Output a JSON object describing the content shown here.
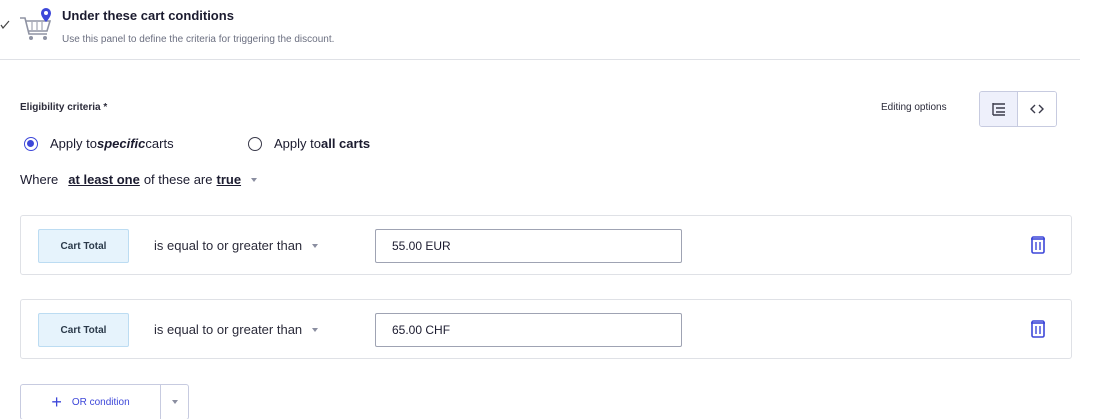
{
  "header": {
    "title": "Under these cart conditions",
    "description": "Use this panel to define the criteria for triggering the discount."
  },
  "eligibility": {
    "label": "Eligibility criteria *",
    "editing_options_label": "Editing options"
  },
  "radios": [
    {
      "prefix": "Apply to ",
      "emphasis": "specific",
      "suffix": " carts",
      "checked": true
    },
    {
      "prefix": "Apply to ",
      "emphasis": "all carts",
      "suffix": "",
      "checked": false
    }
  ],
  "where": {
    "prefix": "Where",
    "quantifier": "at least one",
    "middle": "of these are",
    "value": "true"
  },
  "conditions": [
    {
      "field": "Cart Total",
      "operator": "is equal to or greater than",
      "value": "55.00 EUR"
    },
    {
      "field": "Cart Total",
      "operator": "is equal to or greater than",
      "value": "65.00 CHF"
    }
  ],
  "or_button": {
    "label": "OR condition"
  },
  "colors": {
    "accent": "#3d47d9",
    "tag_bg": "#e6f3fc",
    "border": "#dfe1e6"
  },
  "icons": [
    "collapse-check-icon",
    "cart-icon",
    "tree-view-icon",
    "code-view-icon",
    "trash-icon",
    "plus-icon",
    "chevron-down-icon"
  ]
}
